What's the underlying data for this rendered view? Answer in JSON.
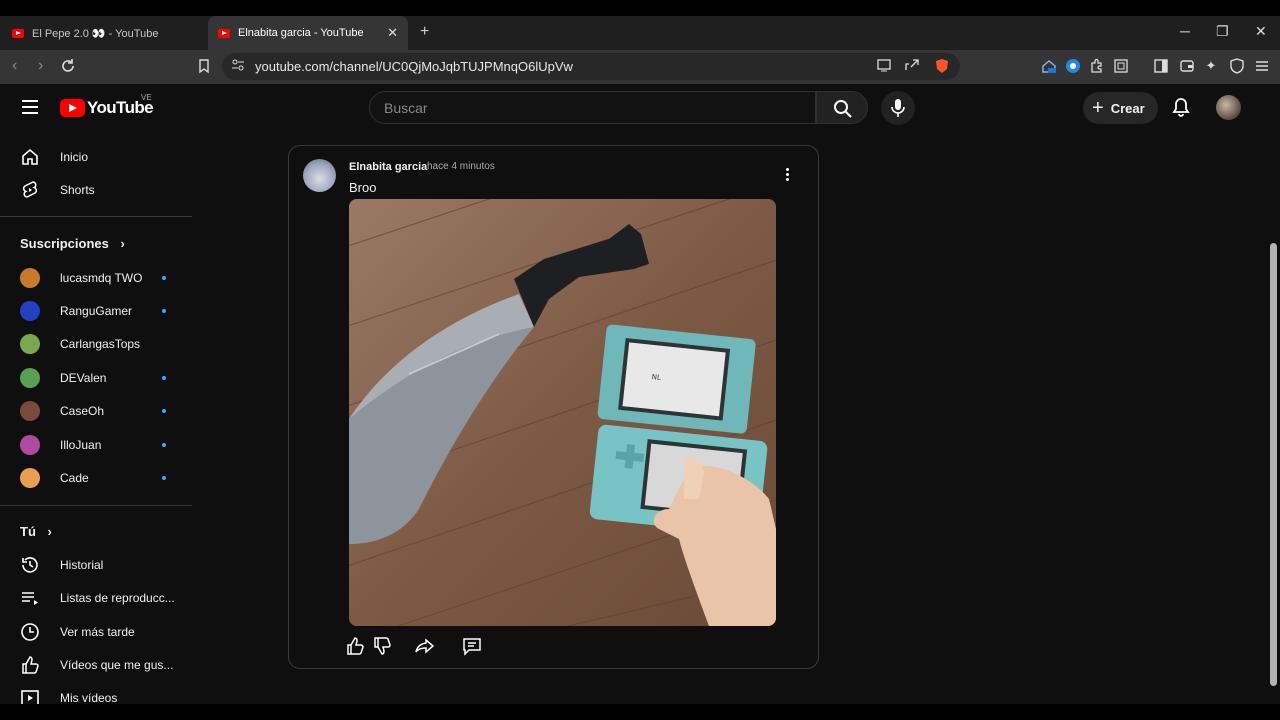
{
  "browser": {
    "tabs": [
      {
        "title": "El Pepe 2.0 👀 - YouTube",
        "active": false
      },
      {
        "title": "Elnabita garcia - YouTube",
        "active": true
      }
    ],
    "url": "youtube.com/channel/UC0QjMoJqbTUJPMnqO6lUpVw"
  },
  "header": {
    "logo_text": "YouTube",
    "country_code": "VE",
    "search_placeholder": "Buscar",
    "create_label": "Crear"
  },
  "sidebar": {
    "main": [
      {
        "label": "Inicio",
        "icon": "home-icon"
      },
      {
        "label": "Shorts",
        "icon": "shorts-icon"
      }
    ],
    "subscriptions_title": "Suscripciones",
    "subscriptions": [
      {
        "name": "lucasmdq TWO",
        "new": true,
        "color": "#c77a2a"
      },
      {
        "name": "RanguGamer",
        "new": true,
        "color": "#2240c8"
      },
      {
        "name": "CarlangasTops",
        "new": false,
        "color": "#7aa84a"
      },
      {
        "name": "DEValen",
        "new": true,
        "color": "#5aa052"
      },
      {
        "name": "CaseOh",
        "new": true,
        "color": "#7a4a3a"
      },
      {
        "name": "IlloJuan",
        "new": true,
        "color": "#b04aa0"
      },
      {
        "name": "Cade",
        "new": true,
        "color": "#e8a050"
      }
    ],
    "you_title": "Tú",
    "you": [
      {
        "label": "Historial",
        "icon": "history-icon"
      },
      {
        "label": "Listas de reproducc...",
        "icon": "playlists-icon"
      },
      {
        "label": "Ver más tarde",
        "icon": "watch-later-icon"
      },
      {
        "label": "Vídeos que me gus...",
        "icon": "liked-icon"
      },
      {
        "label": "Mis vídeos",
        "icon": "my-videos-icon"
      }
    ]
  },
  "post": {
    "author": "Elnabita garcia",
    "time": "hace 4 minutos",
    "text": "Broo",
    "image_description": "machete-and-nintendo-dsi-on-wooden-floor"
  }
}
